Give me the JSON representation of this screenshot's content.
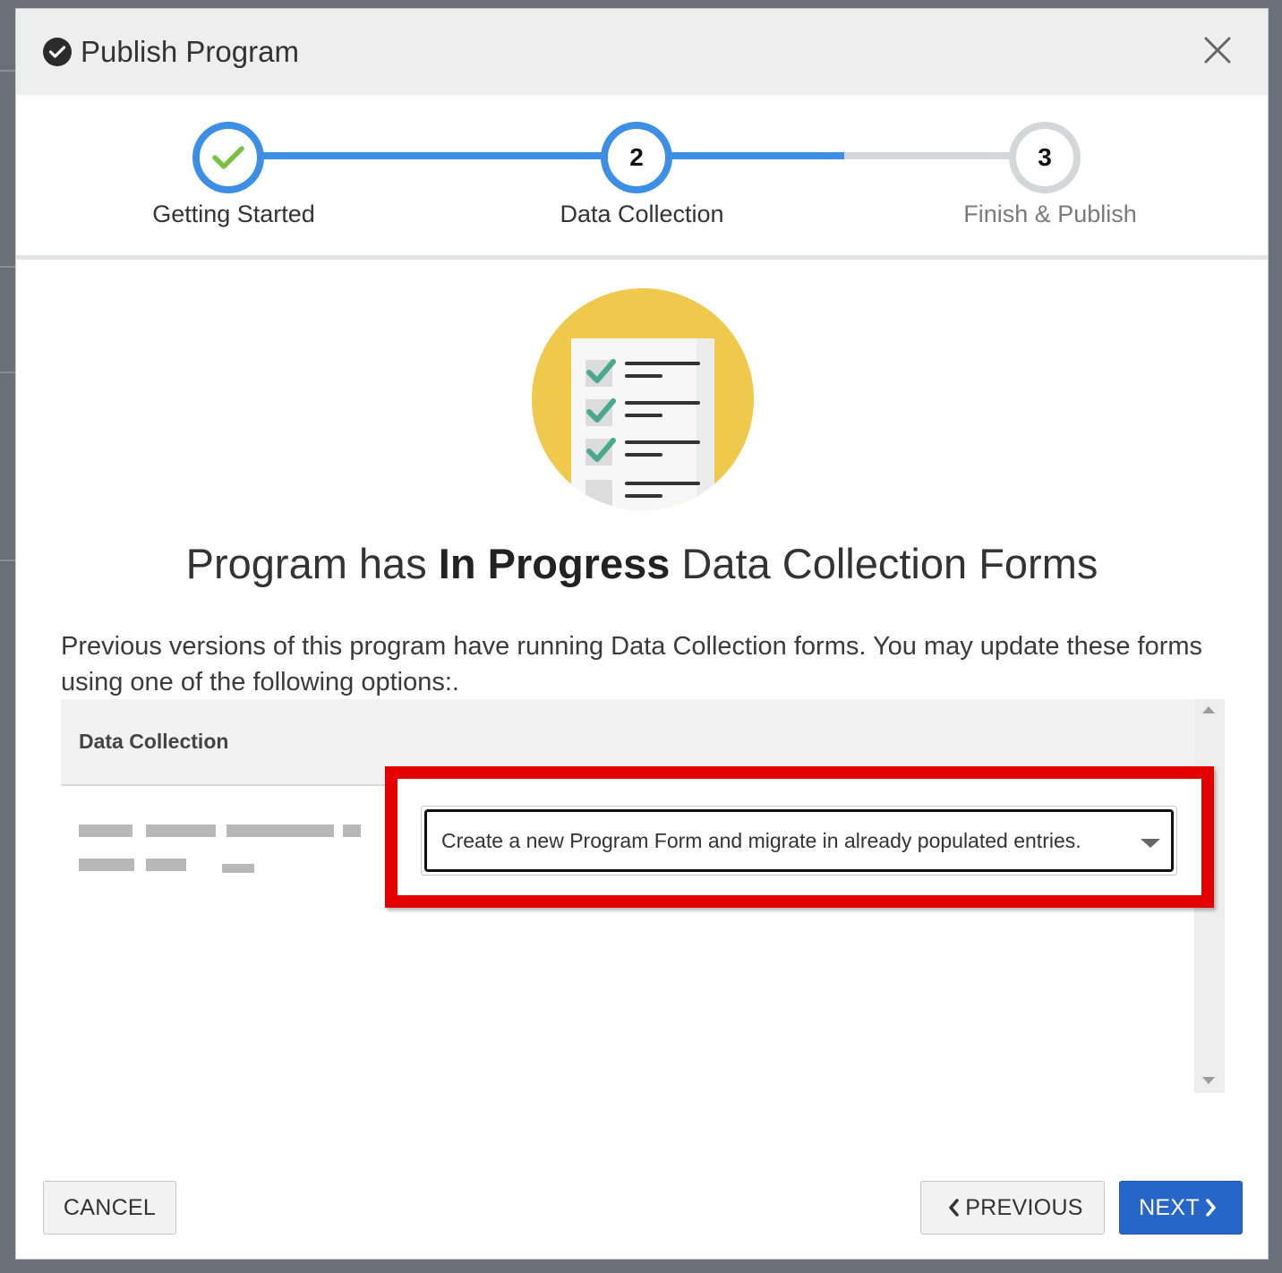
{
  "dialog": {
    "title": "Publish Program"
  },
  "stepper": {
    "steps": [
      {
        "number": "",
        "label": "Getting Started",
        "state": "complete"
      },
      {
        "number": "2",
        "label": "Data Collection",
        "state": "active"
      },
      {
        "number": "3",
        "label": "Finish & Publish",
        "state": "pending"
      }
    ]
  },
  "content": {
    "heading_prefix": "Program has ",
    "heading_bold": "In Progress",
    "heading_suffix": " Data Collection Forms",
    "description": "Previous versions of this program have running Data Collection forms. You may update these forms using one of the following options:.",
    "table": {
      "column_header": "Data Collection"
    },
    "migration_select": {
      "value": "Create a new Program Form and migrate in already populated entries."
    }
  },
  "footer": {
    "cancel_label": "CANCEL",
    "previous_label": "PREVIOUS",
    "next_label": "NEXT"
  },
  "colors": {
    "accent": "#3d8fe6",
    "primary_button": "#2766c9",
    "highlight": "#e20000",
    "illustration_bg": "#efc94c",
    "check_green": "#7ac142"
  }
}
